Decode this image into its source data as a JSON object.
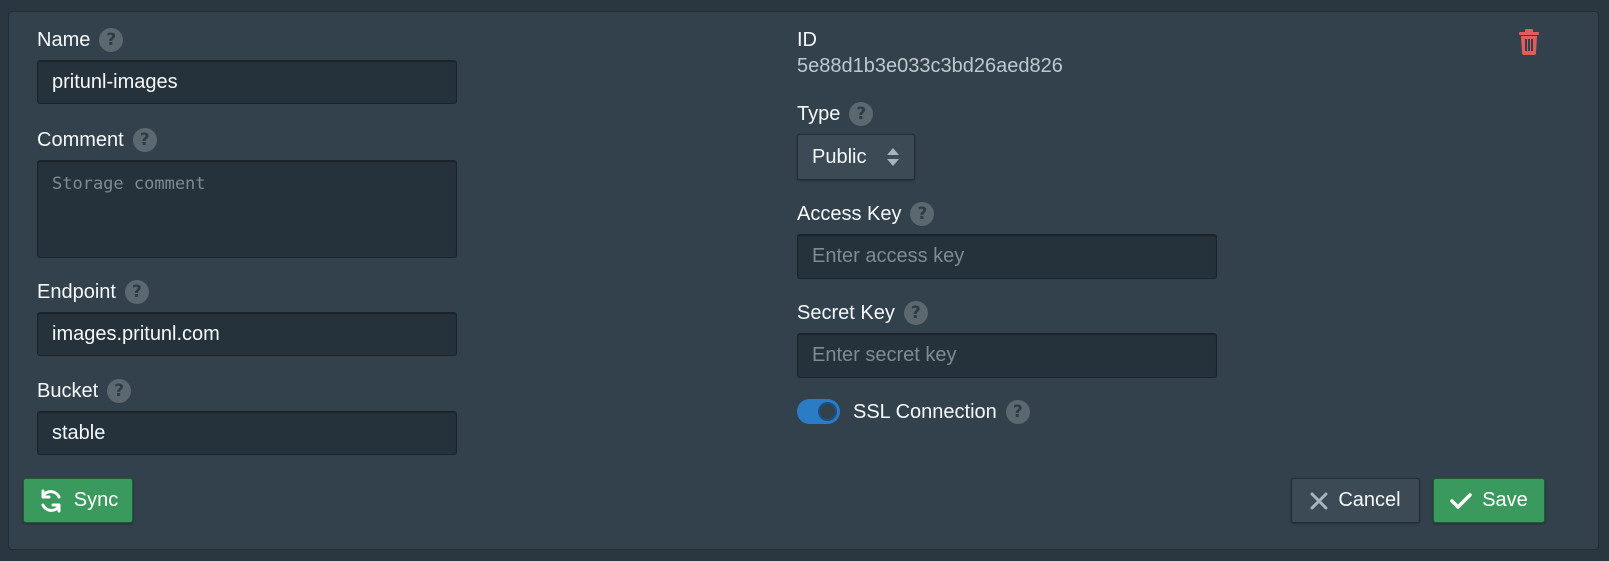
{
  "fields": {
    "name": {
      "label": "Name",
      "value": "pritunl-images"
    },
    "comment": {
      "label": "Comment",
      "value": "",
      "placeholder": "Storage comment"
    },
    "endpoint": {
      "label": "Endpoint",
      "value": "images.pritunl.com"
    },
    "bucket": {
      "label": "Bucket",
      "value": "stable"
    },
    "id": {
      "label": "ID",
      "value": "5e88d1b3e033c3bd26aed826"
    },
    "type": {
      "label": "Type",
      "selected": "Public"
    },
    "access_key": {
      "label": "Access Key",
      "value": "",
      "placeholder": "Enter access key"
    },
    "secret_key": {
      "label": "Secret Key",
      "value": "",
      "placeholder": "Enter secret key"
    },
    "ssl": {
      "label": "SSL Connection",
      "enabled": true
    }
  },
  "help_glyph": "?",
  "buttons": {
    "sync": "Sync",
    "cancel": "Cancel",
    "save": "Save"
  },
  "icons": {
    "delete": "trash-icon",
    "sync": "sync-icon",
    "cancel": "close-icon",
    "save": "check-icon",
    "help": "help-icon",
    "select": "select-arrows-icon"
  },
  "colors": {
    "panel_bg": "#33414c",
    "input_bg": "#26323b",
    "accent_blue": "#2a7cc7",
    "success_green": "#3a9a5d",
    "danger_red": "#e25c5c"
  }
}
